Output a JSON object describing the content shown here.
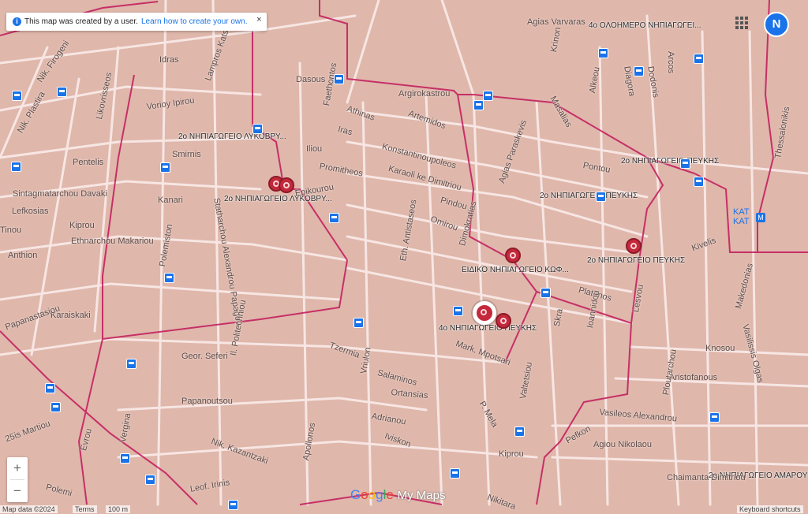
{
  "notice": {
    "text": "This map was created by a user.",
    "link": "Learn how to create your own.",
    "close": "×"
  },
  "avatar": "N",
  "zoom": {
    "in": "+",
    "out": "−"
  },
  "brand": {
    "g": "Google",
    "mymaps": "My Maps"
  },
  "footer": {
    "map_data": "Map data ©2024",
    "terms": "Terms",
    "scale": "100 m",
    "shortcuts": "Keyboard shortcuts"
  },
  "metro": {
    "label": "ΚΑΤ"
  },
  "places": [
    {
      "text": "4ο ΟΛΟΗΜΕΡΟ ΝΗΠΙΑΓΩΓΕΙΟ ΠΕΥΚΗΣ",
      "display": "4ο ΟΛΟΗΜΕΡΟ ΝΗΠΙΑΓΩΓΕΙ..."
    },
    {
      "text": "2ο ΝΗΠΙΑΓΩΓΕΙΟ ΛΥΚΟΒΡΥΣΗΣ",
      "display": "2ο ΝΗΠΙΑΓΩΓΕΙΟ ΛΥΚΟΒΡΥ..."
    },
    {
      "text": "2ο ΝΗΠΙΑΓΩΓΕΙΟ ΛΥΚΟΒΡΥΣΗΣ",
      "display": "2ο ΝΗΠΙΑΓΩΓΕΙΟ ΛΥΚΟΒΡΥ..."
    },
    {
      "text": "2ο ΝΗΠΙΑΓΩΓΕΙΟ ΠΕΥΚΗΣ",
      "display": "2ο ΝΗΠΙΑΓΩΓΕΙΟ ΠΕΥΚΗΣ"
    },
    {
      "text": "2ο ΝΗΠΙΑΓΩΓΕΙΟ ΠΕΥΚΗΣ",
      "display": "2ο ΝΗΠΙΑΓΩΓΕΙΟ ΠΕΥΚΗΣ"
    },
    {
      "text": "ΕΙΔΙΚΟ ΝΗΠΙΑΓΩΓΕΙΟ ΚΗΦΙΣΙΑΣ",
      "display": "ΕΙΔΙΚΟ ΝΗΠΙΑΓΩΓΕΙΟ ΚΩΦ..."
    },
    {
      "text": "2ο ΝΗΠΙΑΓΩΓΕΙΟ ΠΕΥΚΗΣ",
      "display": "2ο ΝΗΠΙΑΓΩΓΕΙΟ ΠΕΥΚΗΣ"
    },
    {
      "text": "4ο ΝΗΠΙΑΓΩΓΕΙΟ ΠΕΥΚΗΣ",
      "display": "4ο ΝΗΠΙΑΓΩΓΕΙΟ ΠΕΥΚΗΣ"
    },
    {
      "text": "2ο ΝΗΠΙΑΓΩΓΕΙΟ ΑΜΑΡΟΥΣΙΟΥ",
      "display": "2ο ΝΗΠΙΑΓΩΓΕΙΟ ΑΜΑΡΟΥ"
    }
  ],
  "streets": [
    "Agias Varvaras",
    "Idras",
    "Dasous",
    "Vorioy Ipirou",
    "Lampros Katsoni",
    "Likovrisseos",
    "Nik. Plastira",
    "Nik. Firogeni",
    "Athinas",
    "Artemidos",
    "Iras",
    "Faethontos",
    "Argirokastrou",
    "Konstantinoupoleos",
    "Smirnis",
    "Iliou",
    "Promitheos",
    "Karaoli ke Dimitriou",
    "Pentelis",
    "Sintagmatarchou Davaki",
    "Kanari",
    "Lefkosias",
    "Kiprou",
    "Ethnarchou Makariou",
    "Tinou",
    "Anthion",
    "Epikourou",
    "Pindou",
    "Omirou",
    "Dimokratias",
    "Platonos",
    "Pontou",
    "Kivelis",
    "Knosou",
    "Aristofanous",
    "Vasileos Alexandrou",
    "Agiou Nikolaou",
    "Chaimanta Dimitriou",
    "Mark. Mpotsari",
    "Tzermia",
    "Salaminos",
    "Ortansias",
    "Adrianou",
    "Iviskon",
    "Papanoutsou",
    "Geor. Seferi",
    "Nik. Kazantzaki",
    "Apollonos",
    "Vergina",
    "Evrou",
    "Polemi",
    "Karaiskaki",
    "Papanastasiou",
    "25is Martiou",
    "Leof. Irinis",
    "Kiprou",
    "Nikitara",
    "Makedonias",
    "Vasilissis Olgas",
    "Thessalonikis",
    "Alkeou",
    "Diagora",
    "Dodonis",
    "Arcos",
    "Krinon",
    "Masalias",
    "Agias Paraskevis",
    "Statharchou Alexandrou Papagou",
    "Il. Politechniou",
    "Polemiston",
    "Eth. Antistaseos",
    "Vriulon",
    "Ploutarchou",
    "Ioannidou",
    "Lesvou",
    "Valtetsiou",
    "P. Mela",
    "Skra",
    "Pefkon"
  ],
  "bus_stops": 28,
  "markers_count": 7
}
